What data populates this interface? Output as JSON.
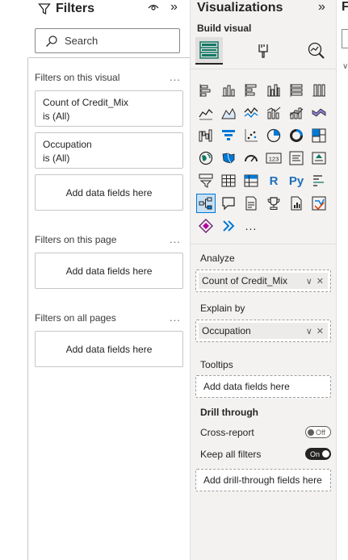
{
  "filters": {
    "title": "Filters",
    "search_placeholder": "Search",
    "on_visual": {
      "label": "Filters on this visual",
      "more": "...",
      "cards": [
        {
          "field": "Count of Credit_Mix",
          "value": "is (All)"
        },
        {
          "field": "Occupation",
          "value": "is (All)"
        }
      ],
      "drop": "Add data fields here"
    },
    "on_page": {
      "label": "Filters on this page",
      "more": "...",
      "drop": "Add data fields here"
    },
    "on_all": {
      "label": "Filters on all pages",
      "more": "...",
      "drop": "Add data fields here"
    }
  },
  "viz": {
    "title": "Visualizations",
    "build_visual": "Build visual",
    "more_visuals": "...",
    "analyze": {
      "label": "Analyze",
      "field": "Count of Credit_Mix"
    },
    "explain_by": {
      "label": "Explain by",
      "field": "Occupation"
    },
    "tooltips": {
      "label": "Tooltips",
      "drop": "Add data fields here"
    },
    "drill_through": {
      "label": "Drill through",
      "cross_report": {
        "label": "Cross-report",
        "state": "Off"
      },
      "keep_all_filters": {
        "label": "Keep all filters",
        "state": "On"
      },
      "drop": "Add drill-through fields here"
    },
    "r_label": "R",
    "py_label": "Py",
    "card_number": "123"
  },
  "fields_pane": {
    "title_fragment": "F"
  },
  "colors": {
    "accent": "#0078d4",
    "selected_bg": "#c7e0f4",
    "pane_bg": "#f3f2f1"
  }
}
